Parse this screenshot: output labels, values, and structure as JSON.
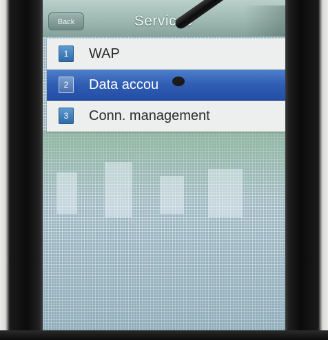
{
  "header": {
    "back_label": "Back",
    "title": "Services"
  },
  "menu": {
    "items": [
      {
        "number": "1",
        "label": "WAP",
        "selected": false
      },
      {
        "number": "2",
        "label": "Data accou",
        "selected": true
      },
      {
        "number": "3",
        "label": "Conn. management",
        "selected": false
      }
    ]
  },
  "colors": {
    "selection": "#2f5db4",
    "titlebar": "#9fbab3",
    "wallpaper": "#9fb9c4"
  }
}
